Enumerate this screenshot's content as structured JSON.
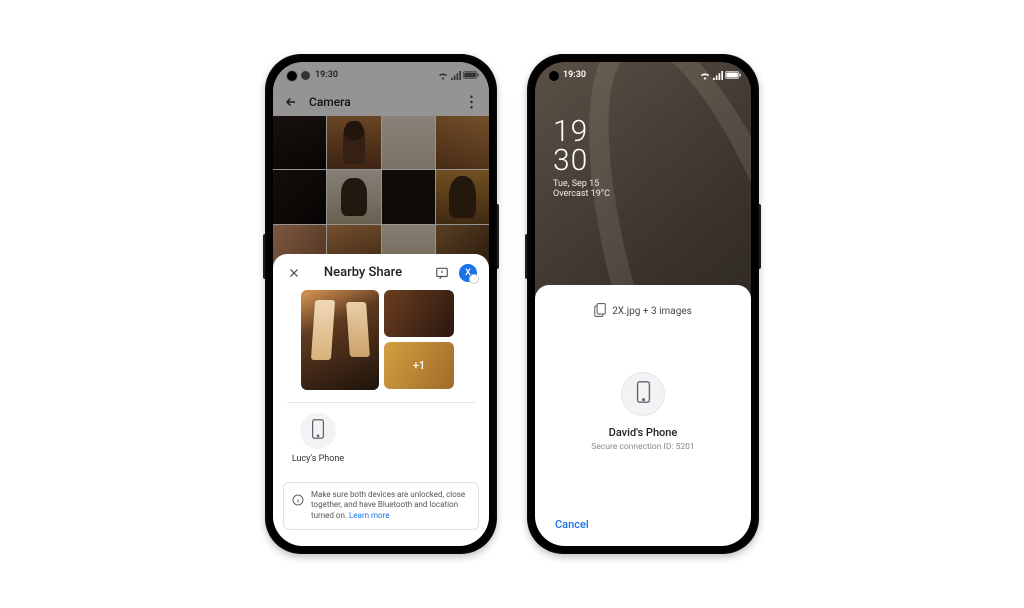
{
  "statusbar": {
    "time": "19:30"
  },
  "left": {
    "app_title": "Camera",
    "sheet_title": "Nearby Share",
    "avatar_initial": "X",
    "more_count": "+1",
    "target_label": "Lucy's Phone",
    "info_text": "Make sure both devices are unlocked, close together, and have Bluetooth and location turned on.",
    "info_link": "Learn more"
  },
  "right": {
    "clock_h": "19",
    "clock_m": "30",
    "date": "Tue, Sep 15",
    "weather": "Overcast 19°C",
    "file_summary": "2X.jpg + 3 images",
    "sender_name": "David's Phone",
    "connection_id": "Secure connection ID: 5201",
    "cancel": "Cancel"
  }
}
